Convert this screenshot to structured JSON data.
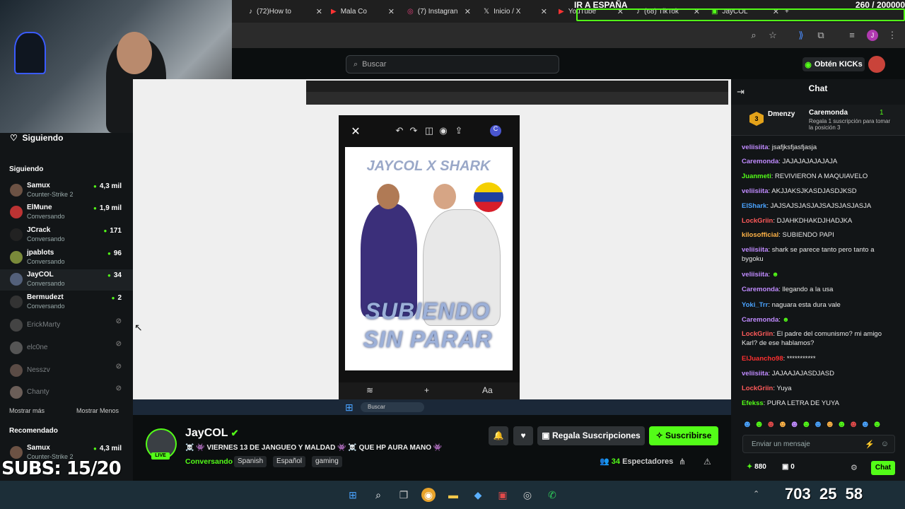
{
  "browser": {
    "tabs": [
      {
        "label": "(72)How to",
        "icon": "tiktok-icon"
      },
      {
        "label": "Mala Co",
        "icon": "youtube-icon"
      },
      {
        "label": "(7) Instagran",
        "icon": "instagram-icon"
      },
      {
        "label": "Inicio / X",
        "icon": "x-icon"
      },
      {
        "label": "YouTube",
        "icon": "youtube-icon"
      },
      {
        "label": "(68) TikTok",
        "icon": "tiktok-icon"
      },
      {
        "label": "JayCOL",
        "icon": "kick-icon"
      }
    ]
  },
  "overlay": {
    "banner": "IR A ESPAÑA",
    "sub_goal": "260 / 200000",
    "subs": "SUBS: 15/20",
    "clock_a": "703",
    "clock_b": "25",
    "clock_c": "58"
  },
  "header": {
    "search_placeholder": "Buscar",
    "kicks_label": "Obtén KICKs"
  },
  "sidebar": {
    "following_title": "Siguiendo",
    "section_label": "Siguiendo",
    "channels": [
      {
        "name": "Samux",
        "sub": "Counter-Strike 2",
        "count": "4,3 mil",
        "live": true
      },
      {
        "name": "ElMune",
        "sub": "Conversando",
        "count": "1,9 mil",
        "live": true
      },
      {
        "name": "JCrack",
        "sub": "Conversando",
        "count": "171",
        "live": true
      },
      {
        "name": "jpablots",
        "sub": "Conversando",
        "count": "96",
        "live": true
      },
      {
        "name": "JayCOL",
        "sub": "Conversando",
        "count": "34",
        "live": true
      },
      {
        "name": "Bermudezt",
        "sub": "Conversando",
        "count": "2",
        "live": true
      },
      {
        "name": "ErickMarty",
        "sub": "",
        "count": "",
        "live": false
      },
      {
        "name": "elc0ne",
        "sub": "",
        "count": "",
        "live": false
      },
      {
        "name": "Nesszv",
        "sub": "",
        "count": "",
        "live": false
      },
      {
        "name": "Chanty",
        "sub": "",
        "count": "",
        "live": false
      }
    ],
    "show_more": "Mostrar más",
    "show_less": "Mostrar Menos",
    "recommended_label": "Recomendado",
    "recommended": [
      {
        "name": "Samux",
        "sub": "Counter-Strike 2",
        "count": "4,3 mil"
      }
    ]
  },
  "stream": {
    "post_title": "JAYCOL X SHARK",
    "post_subtitle_1": "SUBIENDO",
    "post_subtitle_2": "SIN PARAR",
    "dialog_aa": "Aa",
    "taskbar_search": "Buscar"
  },
  "channel": {
    "name": "JayCOL",
    "live_badge": "LIVE",
    "title": "☠️ 👾 VIERNES 13 DE JANGUEO Y MALDAD 👾 ☠️ QUE HP AURA MANO 👾",
    "category": "Conversando",
    "tags": [
      "Spanish",
      "Español",
      "gaming"
    ],
    "gift_label": "Regala Suscripciones",
    "subscribe_label": "Suscribirse",
    "viewers_count": "34",
    "viewers_label": "Espectadores"
  },
  "chat": {
    "title": "Chat",
    "pinned": {
      "user": "Dmenzy",
      "count": "3",
      "gifter": "Caremonda",
      "gift_count": "1",
      "message": "Regala 1 suscripción para tomar la posición 3"
    },
    "messages": [
      {
        "user": "veliisiita",
        "color": "#c08bff",
        "text": "jsafjksfjasfjasja"
      },
      {
        "user": "Caremonda",
        "color": "#c08bff",
        "text": "JAJAJAJAJAJAJA"
      },
      {
        "user": "Juanmeti",
        "color": "#53fc18",
        "text": "REVIVIERON A MAQUIAVELO"
      },
      {
        "user": "veliisiita",
        "color": "#c08bff",
        "text": "AKJJAKSJKASDJASDJKSD"
      },
      {
        "user": "ElShark",
        "color": "#4aa3ff",
        "text": "JAJSAJSJASJAJSAJSJASJASJA"
      },
      {
        "user": "LockGriin",
        "color": "#ff5a5a",
        "text": "DJAHKDHAKDJHADJKA"
      },
      {
        "user": "kilosofficial",
        "color": "#ffb347",
        "text": "SUBIENDO PAPI"
      },
      {
        "user": "veliisiita",
        "color": "#c08bff",
        "text": "shark se parece tanto pero tanto a bygoku"
      },
      {
        "user": "veliisiita",
        "color": "#c08bff",
        "text": ""
      },
      {
        "user": "Caremonda",
        "color": "#c08bff",
        "text": "llegando a la usa"
      },
      {
        "user": "Yoki_Trr",
        "color": "#4aa3ff",
        "text": "naguara esta dura vale"
      },
      {
        "user": "Caremonda",
        "color": "#c08bff",
        "text": ""
      },
      {
        "user": "LockGriin",
        "color": "#ff5a5a",
        "text": "El padre del comunismo? mi amigo Karl? de ese hablamos?"
      },
      {
        "user": "ElJuancho98",
        "color": "#ff3030",
        "text": "***********"
      },
      {
        "user": "veliisiita",
        "color": "#c08bff",
        "text": "JAJAAJAJASDJASD"
      },
      {
        "user": "LockGriin",
        "color": "#ff5a5a",
        "text": "Yuya"
      },
      {
        "user": "Efekss",
        "color": "#53fc18",
        "text": "PURA LETRA DE YUYA"
      }
    ],
    "input_placeholder": "Enviar un mensaje",
    "points": "880",
    "gifts": "0",
    "send_label": "Chat"
  },
  "colors": {
    "kick_green": "#53fc18",
    "bg": "#0b0e0f",
    "panel": "#121517"
  }
}
